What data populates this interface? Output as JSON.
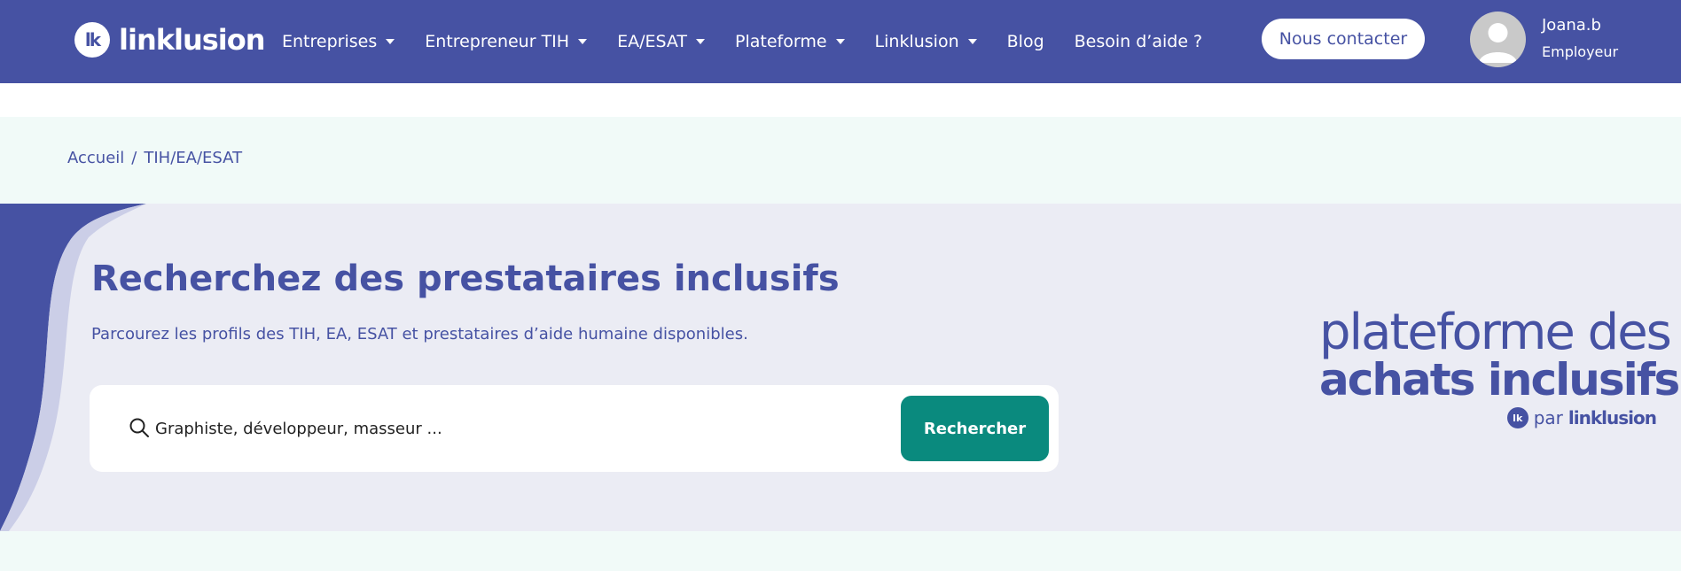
{
  "header": {
    "logo_mark": "lk",
    "logo_text": "linklusion",
    "nav": [
      {
        "label": "Entreprises",
        "dropdown": true
      },
      {
        "label": "Entrepreneur TIH",
        "dropdown": true
      },
      {
        "label": "EA/ESAT",
        "dropdown": true
      },
      {
        "label": "Plateforme",
        "dropdown": true
      },
      {
        "label": "Linklusion",
        "dropdown": true
      },
      {
        "label": "Blog",
        "dropdown": false
      },
      {
        "label": "Besoin d’aide ?",
        "dropdown": false
      }
    ],
    "contact_label": "Nous contacter",
    "user": {
      "name": "Joana.b",
      "role": "Employeur"
    }
  },
  "breadcrumb": {
    "home": "Accueil",
    "separator": "/",
    "current": "TIH/EA/ESAT"
  },
  "hero": {
    "title": "Recherchez des prestataires inclusifs",
    "subtitle": "Parcourez les profils des TIH, EA, ESAT et prestataires d’aide humaine disponibles.",
    "search": {
      "placeholder": "Graphiste, développeur, masseur ...",
      "button_label": "Rechercher"
    },
    "brand": {
      "line1": "plateforme des",
      "line2": "achats inclusifs",
      "mark": "lk",
      "par": "par",
      "name": "linklusion"
    }
  },
  "colors": {
    "primary": "#4652a3",
    "accent": "#0a8a7e",
    "hero_bg": "#ebecf4",
    "band_bg": "#f1faf8"
  }
}
